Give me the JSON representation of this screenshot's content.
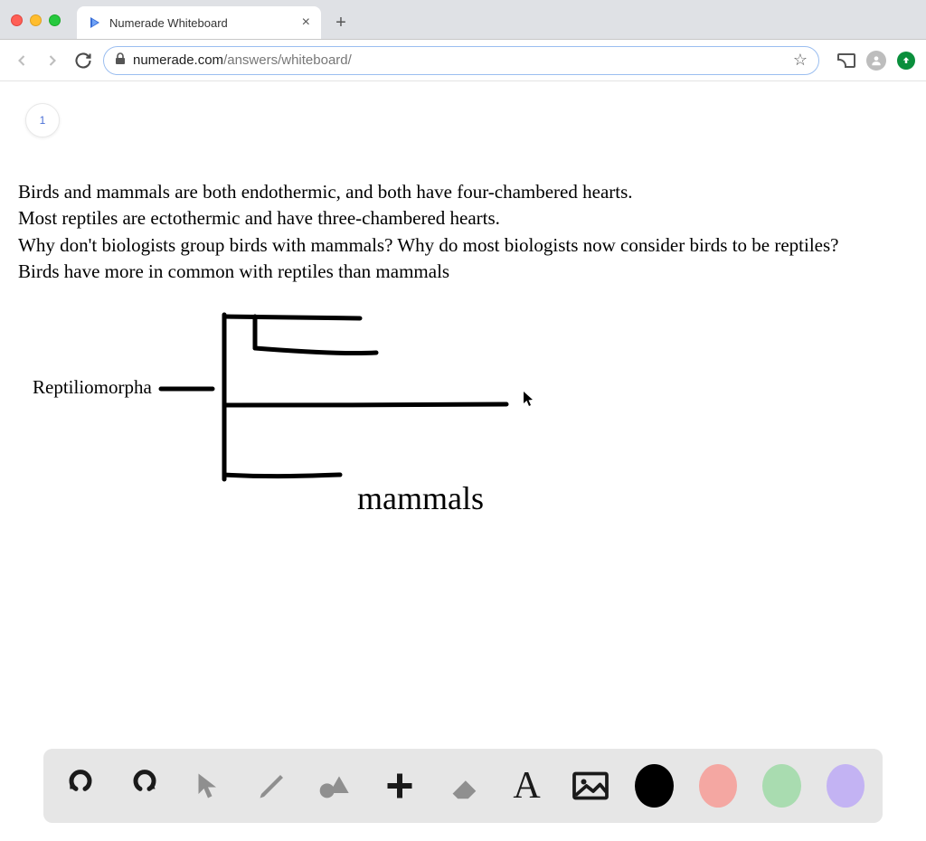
{
  "browser": {
    "tab_title": "Numerade Whiteboard",
    "url_domain": "numerade.com",
    "url_path": "/answers/whiteboard/"
  },
  "page": {
    "number": "1",
    "text_lines": [
      "Birds and mammals are both endothermic, and both have four-chambered hearts.",
      "Most reptiles are ectothermic and have three-chambered hearts.",
      "Why don't biologists group birds with mammals?  Why do most biologists now consider birds to be reptiles?",
      "Birds have more in common with reptiles than mammals"
    ],
    "diagram": {
      "label_left": "Reptiliomorpha",
      "label_bottom": "mammals"
    }
  },
  "toolbar": {
    "colors": {
      "black": "#000000",
      "red": "#f4a7a2",
      "green": "#a9dcb0",
      "purple": "#c3b3f3"
    }
  }
}
